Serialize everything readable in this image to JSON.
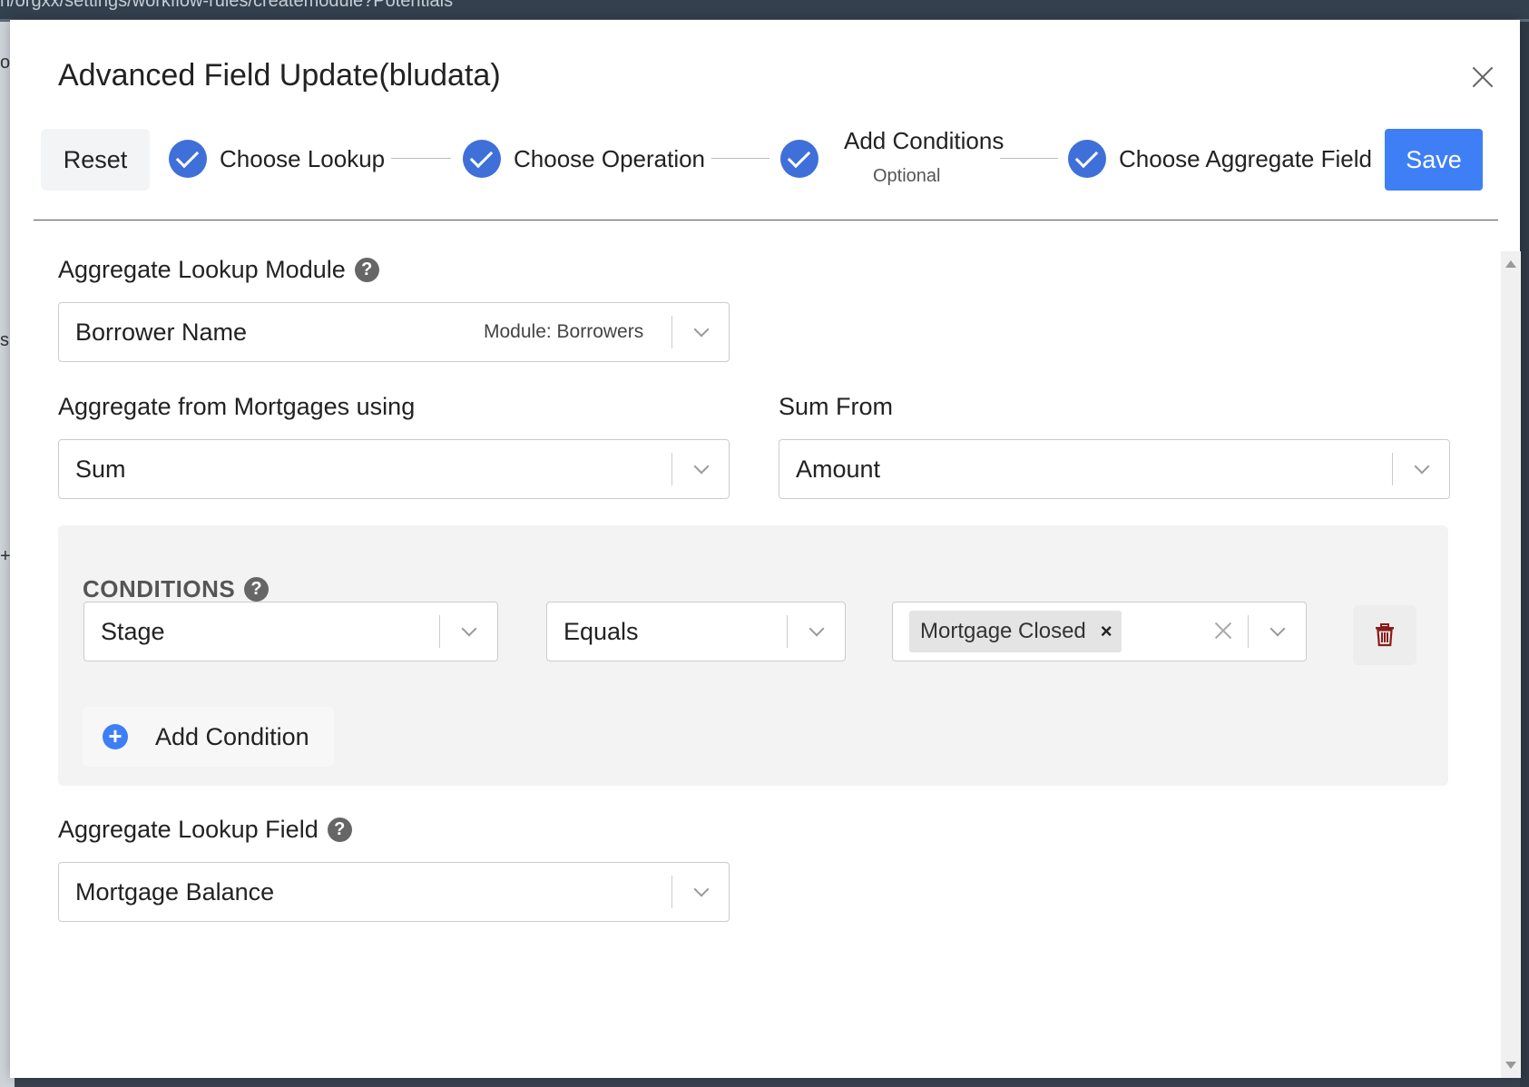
{
  "browser": {
    "url": "n/orgxx/settings/workflow-rules/createmodule?Potentials"
  },
  "background": {
    "fragments": [
      "o",
      "s",
      "+"
    ]
  },
  "modal": {
    "title": "Advanced Field Update(bludata)",
    "reset_label": "Reset",
    "save_label": "Save",
    "steps": [
      {
        "label": "Choose Lookup",
        "completed": true
      },
      {
        "label": "Choose Operation",
        "completed": true
      },
      {
        "label": "Add Conditions",
        "sublabel": "Optional",
        "completed": true
      },
      {
        "label": "Choose Aggregate Field",
        "completed": true
      }
    ]
  },
  "lookup_module": {
    "label": "Aggregate Lookup Module",
    "value": "Borrower Name",
    "meta": "Module: Borrowers"
  },
  "aggregate_op": {
    "label": "Aggregate from Mortgages using",
    "value": "Sum"
  },
  "sum_from": {
    "label": "Sum From",
    "value": "Amount"
  },
  "conditions": {
    "title": "CONDITIONS",
    "rows": [
      {
        "field": "Stage",
        "operator": "Equals",
        "values": [
          "Mortgage Closed"
        ]
      }
    ],
    "add_label": "Add Condition"
  },
  "lookup_field": {
    "label": "Aggregate Lookup Field",
    "value": "Mortgage Balance"
  },
  "colors": {
    "accent": "#3f7ff5",
    "step_check": "#3f6fd8",
    "trash": "#8b1c1c"
  }
}
